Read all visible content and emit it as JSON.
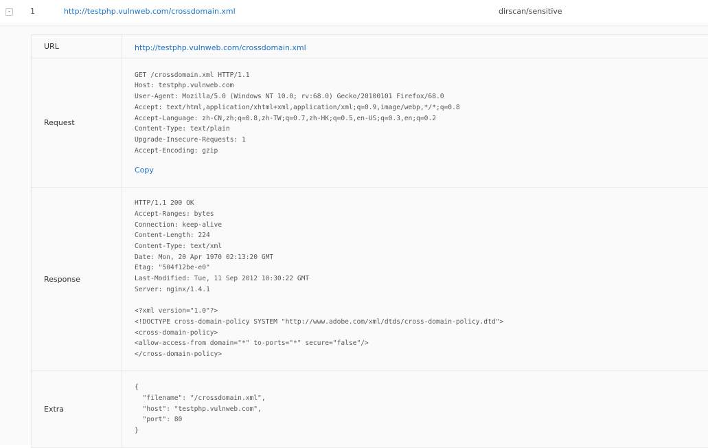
{
  "result_row": {
    "toggle_symbol": "-",
    "index": "1",
    "url": "http://testphp.vulnweb.com/crossdomain.xml",
    "plugin": "dirscan/sensitive"
  },
  "detail": {
    "url_label": "URL",
    "url_value": "http://testphp.vulnweb.com/crossdomain.xml",
    "request_label": "Request",
    "request_body": "GET /crossdomain.xml HTTP/1.1\nHost: testphp.vulnweb.com\nUser-Agent: Mozilla/5.0 (Windows NT 10.0; rv:68.0) Gecko/20100101 Firefox/68.0\nAccept: text/html,application/xhtml+xml,application/xml;q=0.9,image/webp,*/*;q=0.8\nAccept-Language: zh-CN,zh;q=0.8,zh-TW;q=0.7,zh-HK;q=0.5,en-US;q=0.3,en;q=0.2\nContent-Type: text/plain\nUpgrade-Insecure-Requests: 1\nAccept-Encoding: gzip",
    "copy_label": "Copy",
    "response_label": "Response",
    "response_body": "HTTP/1.1 200 OK\nAccept-Ranges: bytes\nConnection: keep-alive\nContent-Length: 224\nContent-Type: text/xml\nDate: Mon, 20 Apr 1970 02:13:20 GMT\nEtag: \"504f12be-e0\"\nLast-Modified: Tue, 11 Sep 2012 10:30:22 GMT\nServer: nginx/1.4.1\n\n<?xml version=\"1.0\"?>\n<!DOCTYPE cross-domain-policy SYSTEM \"http://www.adobe.com/xml/dtds/cross-domain-policy.dtd\">\n<cross-domain-policy>\n<allow-access-from domain=\"*\" to-ports=\"*\" secure=\"false\"/>\n</cross-domain-policy>",
    "extra_label": "Extra",
    "extra_body": "{\n  \"filename\": \"/crossdomain.xml\",\n  \"host\": \"testphp.vulnweb.com\",\n  \"port\": 80\n}"
  },
  "colors": {
    "link": "#1a73c4",
    "border": "#e8e8e8",
    "panel_bg": "#fafafa"
  }
}
